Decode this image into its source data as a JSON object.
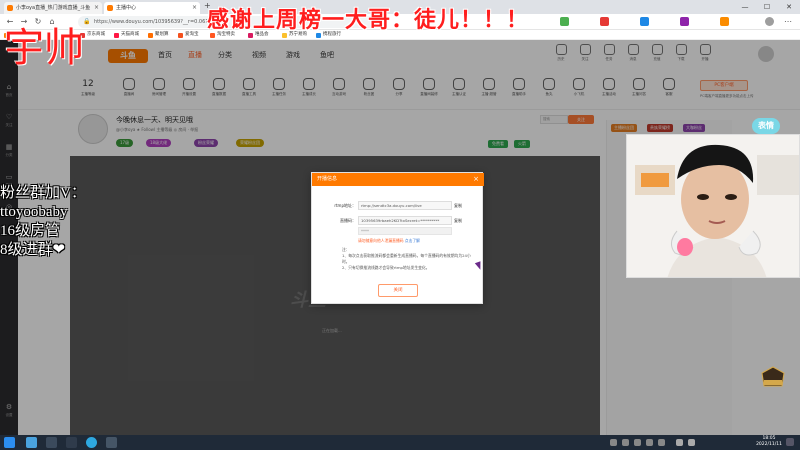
{
  "browser": {
    "tabs": [
      {
        "title": "小李oya直播_热门游戏直播_斗鱼"
      },
      {
        "title": "主播中心"
      }
    ],
    "new_tab": "+",
    "url": "https://www.douyu.com/10395639?__r=0.061393",
    "bookmarks": [
      "斗鱼",
      "京东商城",
      "天猫商城",
      "聚划算",
      "爱淘宝",
      "淘宝特卖",
      "唯品会",
      "苏宁易购",
      "携程旅行"
    ],
    "window_buttons": [
      "—",
      "☐",
      "✕"
    ]
  },
  "left_rail": [
    {
      "label": "首页"
    },
    {
      "label": "关注"
    },
    {
      "label": "分类"
    },
    {
      "label": "直播"
    },
    {
      "label": "游戏"
    },
    {
      "label": "设置"
    }
  ],
  "site_header": {
    "logo": "斗鱼",
    "nav": [
      "首页",
      "直播",
      "分类",
      "视频",
      "游戏",
      "鱼吧"
    ],
    "active_nav": 1,
    "icons": [
      "历史",
      "关注",
      "任务",
      "消息",
      "充值",
      "下载",
      "开播"
    ]
  },
  "toolbar": {
    "level_number": "12",
    "level_label": "主播等级",
    "tools": [
      "直播间",
      "房间管理",
      "开播设置",
      "直播数据",
      "直播工具",
      "主播任务",
      "主播成长",
      "互动游戏",
      "粉丝团",
      "分享",
      "直播间装修",
      "主播认证",
      "主播·超管",
      "直播助手",
      "鱼丸",
      "小飞机",
      "主播活动",
      "主播问答",
      "客服"
    ],
    "pc_button": "PC客户端",
    "pc_note": "PC端客户端直播更多功能点击上传"
  },
  "room": {
    "title": "今晚休息一天、明天见哦",
    "meta": "@小李oya  ★ Followl  主播等级  ◎ 房间 · 举报",
    "tags": [
      "17级",
      "18级大佬",
      "粉丝荣耀",
      "荣耀粉丝团"
    ],
    "search_placeholder": "搜索",
    "follow_label": "关注",
    "badges": [
      "免费看",
      "火箭"
    ]
  },
  "player": {
    "loading_text": "正在加载...",
    "watermark": "斗鱼"
  },
  "right_panel": {
    "tabs": [
      "主播粉丝团",
      "贵族荣耀榜",
      "大咖粉丝"
    ]
  },
  "dialog": {
    "title": "开播信息",
    "fields": [
      {
        "label": "rtmp地址：",
        "value": "rtmp://sendtc3a.douyu.com/live",
        "copy": "复制"
      },
      {
        "label": "直播码：",
        "value": "10395639rbaeh2KD?txSecret=**********",
        "copy": "复制"
      }
    ],
    "masked_note": "****",
    "warning": "请勿随意向他人泄漏直播码",
    "warning_link": "点击了解",
    "notes_title": "注：",
    "notes": [
      "1、每次点击获取推流码都会重新生成直播码，每个直播码的有效期均为24小时。",
      "2、只有切换推流线路才会导致rtmp地址发生变化。"
    ],
    "close_button": "关闭"
  },
  "overlay": {
    "banner": "感谢上周榜一大哥：徒儿！！！",
    "handsome": "宇帅",
    "fan_lines": [
      "粉丝群加V：",
      "ttoyoobaby",
      "16级房管",
      "8级进群❤"
    ],
    "mascot": "表情"
  },
  "taskbar": {
    "time": "18:05",
    "date": "2022/11/11"
  },
  "colors": {
    "brand_orange": "#ff7a00",
    "accent_red": "#ff1e1e"
  }
}
